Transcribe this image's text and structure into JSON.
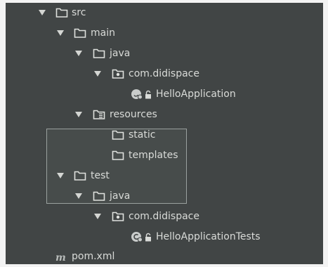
{
  "project_tree": {
    "items": [
      {
        "label": "src",
        "expanded": true,
        "icon": "folder-icon"
      },
      {
        "label": "main",
        "expanded": true,
        "icon": "folder-icon"
      },
      {
        "label": "java",
        "expanded": true,
        "icon": "source-folder-icon"
      },
      {
        "label": "com.didispace",
        "expanded": true,
        "icon": "package-icon"
      },
      {
        "label": "HelloApplication",
        "icon": "spring-class-icon"
      },
      {
        "label": "resources",
        "expanded": true,
        "icon": "resources-folder-icon"
      },
      {
        "label": "static",
        "icon": "folder-icon"
      },
      {
        "label": "templates",
        "icon": "folder-icon"
      },
      {
        "label": "test",
        "expanded": true,
        "icon": "folder-icon"
      },
      {
        "label": "java",
        "expanded": true,
        "icon": "test-source-folder-icon"
      },
      {
        "label": "com.didispace",
        "expanded": true,
        "icon": "package-icon"
      },
      {
        "label": "HelloApplicationTests",
        "icon": "test-class-icon"
      },
      {
        "label": "pom.xml",
        "icon": "maven-icon"
      }
    ]
  },
  "colors": {
    "panel_background": "#414545",
    "text": "#d9dbd8",
    "folder_outline": "#dfe1de",
    "class_icon": "#c9cccb"
  }
}
